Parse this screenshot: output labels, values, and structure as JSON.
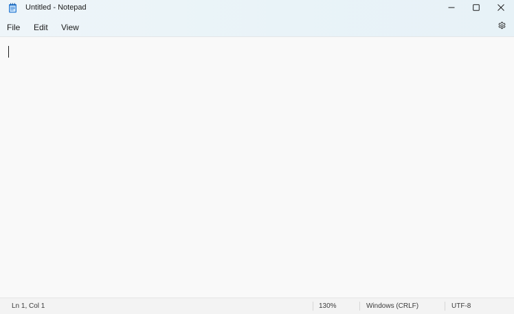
{
  "window": {
    "title": "Untitled - Notepad",
    "app_icon": "notepad-icon",
    "controls": {
      "minimize_icon": "minimize-icon",
      "maximize_icon": "maximize-icon",
      "close_icon": "close-icon"
    }
  },
  "menubar": {
    "items": [
      {
        "label": "File"
      },
      {
        "label": "Edit"
      },
      {
        "label": "View"
      }
    ],
    "settings_icon": "gear-icon"
  },
  "editor": {
    "content": ""
  },
  "statusbar": {
    "position": "Ln 1, Col 1",
    "zoom": "130%",
    "line_ending": "Windows (CRLF)",
    "encoding": "UTF-8"
  },
  "colors": {
    "chrome_background": "#e9f3f8",
    "editor_background": "#f9f9f9",
    "statusbar_background": "#f3f3f3",
    "text": "#1a1a1a",
    "app_icon_accent": "#2b7cd3"
  }
}
